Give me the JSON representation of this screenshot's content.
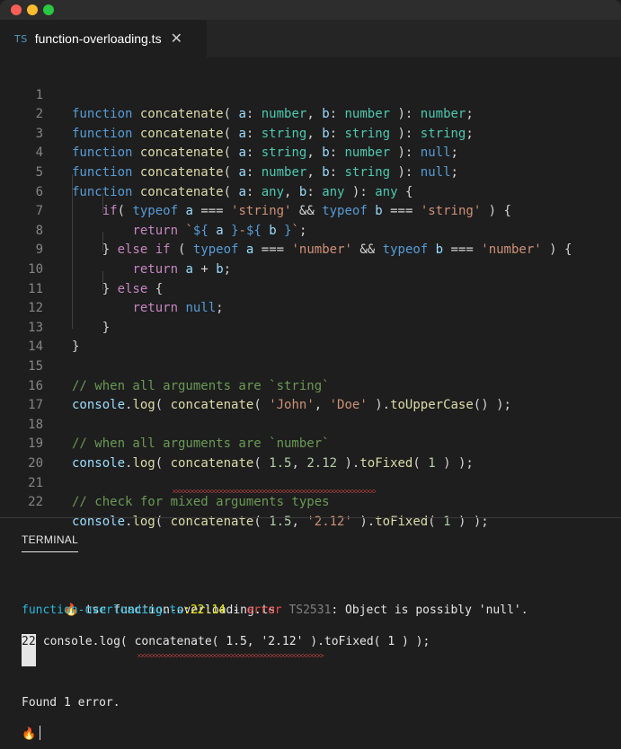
{
  "window": {
    "traffic_lights": [
      "close",
      "minimize",
      "zoom"
    ]
  },
  "tab": {
    "icon": "TS",
    "title": "function-overloading.ts",
    "close": "✕"
  },
  "editor": {
    "line_numbers": [
      "1",
      "2",
      "3",
      "4",
      "5",
      "6",
      "7",
      "8",
      "9",
      "10",
      "11",
      "12",
      "13",
      "14",
      "15",
      "16",
      "17",
      "18",
      "19",
      "20",
      "21",
      "22"
    ],
    "lines": [
      "function concatenate( a: number, b: number ): number;",
      "function concatenate( a: string, b: string ): string;",
      "function concatenate( a: string, b: number ): null;",
      "function concatenate( a: number, b: string ): null;",
      "function concatenate( a: any, b: any ): any {",
      "    if( typeof a === 'string' && typeof b === 'string' ) {",
      "        return `${ a }-${ b }`;",
      "    } else if ( typeof a === 'number' && typeof b === 'number' ) {",
      "        return a + b;",
      "    } else {",
      "        return null;",
      "    }",
      "}",
      "",
      "// when all arguments are `string`",
      "console.log( concatenate( 'John', 'Doe' ).toUpperCase() );",
      "",
      "// when all arguments are `number`",
      "console.log( concatenate( 1.5, 2.12 ).toFixed( 1 ) );",
      "",
      "// check for mixed arguments types",
      "console.log( concatenate( 1.5, '2.12' ).toFixed( 1 ) );"
    ]
  },
  "panel": {
    "tab_label": "TERMINAL"
  },
  "terminal": {
    "prompt_icon": "🔥",
    "command": "tsc function-overloading.ts",
    "error_file": "function-overloading.ts",
    "error_loc": ":22:14",
    "error_sep": " - ",
    "error_word": "error",
    "error_code": "TS2531",
    "error_message": ": Object is possibly 'null'.",
    "snippet_line_no": "22",
    "snippet": " console.log( concatenate( 1.5, '2.12' ).toFixed( 1 ) );",
    "summary": "Found 1 error."
  }
}
